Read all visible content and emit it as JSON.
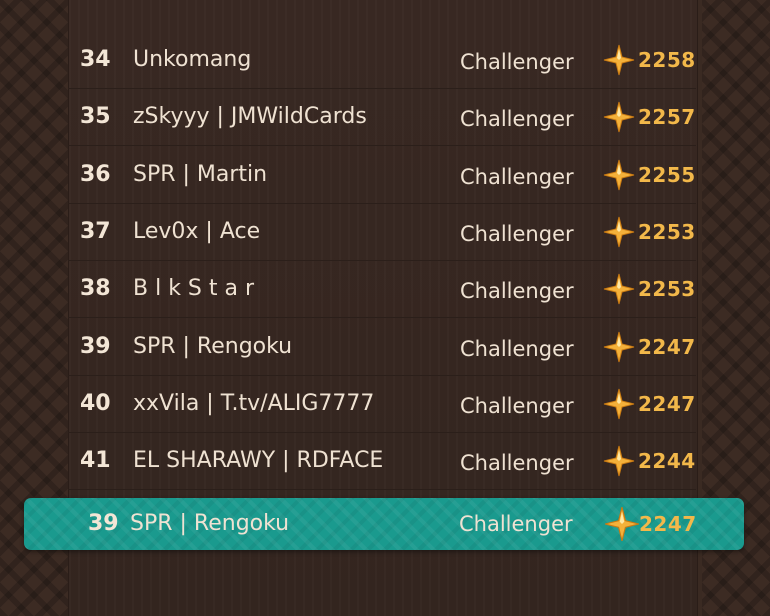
{
  "leaderboard": {
    "rows": [
      {
        "rank": "34",
        "name": "Unkomang",
        "tier": "Challenger",
        "score": "2258"
      },
      {
        "rank": "35",
        "name": "zSkyyy | JMWildCards",
        "tier": "Challenger",
        "score": "2257"
      },
      {
        "rank": "36",
        "name": "SPR | Martin",
        "tier": "Challenger",
        "score": "2255"
      },
      {
        "rank": "37",
        "name": "Lev0x | Ace",
        "tier": "Challenger",
        "score": "2253"
      },
      {
        "rank": "38",
        "name": "B l k S t a r",
        "tier": "Challenger",
        "score": "2253"
      },
      {
        "rank": "39",
        "name": "SPR | Rengoku",
        "tier": "Challenger",
        "score": "2247"
      },
      {
        "rank": "40",
        "name": "xxVila | T.tv/ALIG7777",
        "tier": "Challenger",
        "score": "2247"
      },
      {
        "rank": "41",
        "name": "EL SHARAWY | RDFACE",
        "tier": "Challenger",
        "score": "2244"
      }
    ],
    "current_player": {
      "rank": "39",
      "name": "SPR | Rengoku",
      "tier": "Challenger",
      "score": "2247"
    }
  },
  "colors": {
    "background": "#352620",
    "highlight": "#1a9a8e",
    "score_gold": "#f2b84a",
    "text": "#efe2d2"
  },
  "icons": {
    "score_icon": "gold-star-icon"
  }
}
